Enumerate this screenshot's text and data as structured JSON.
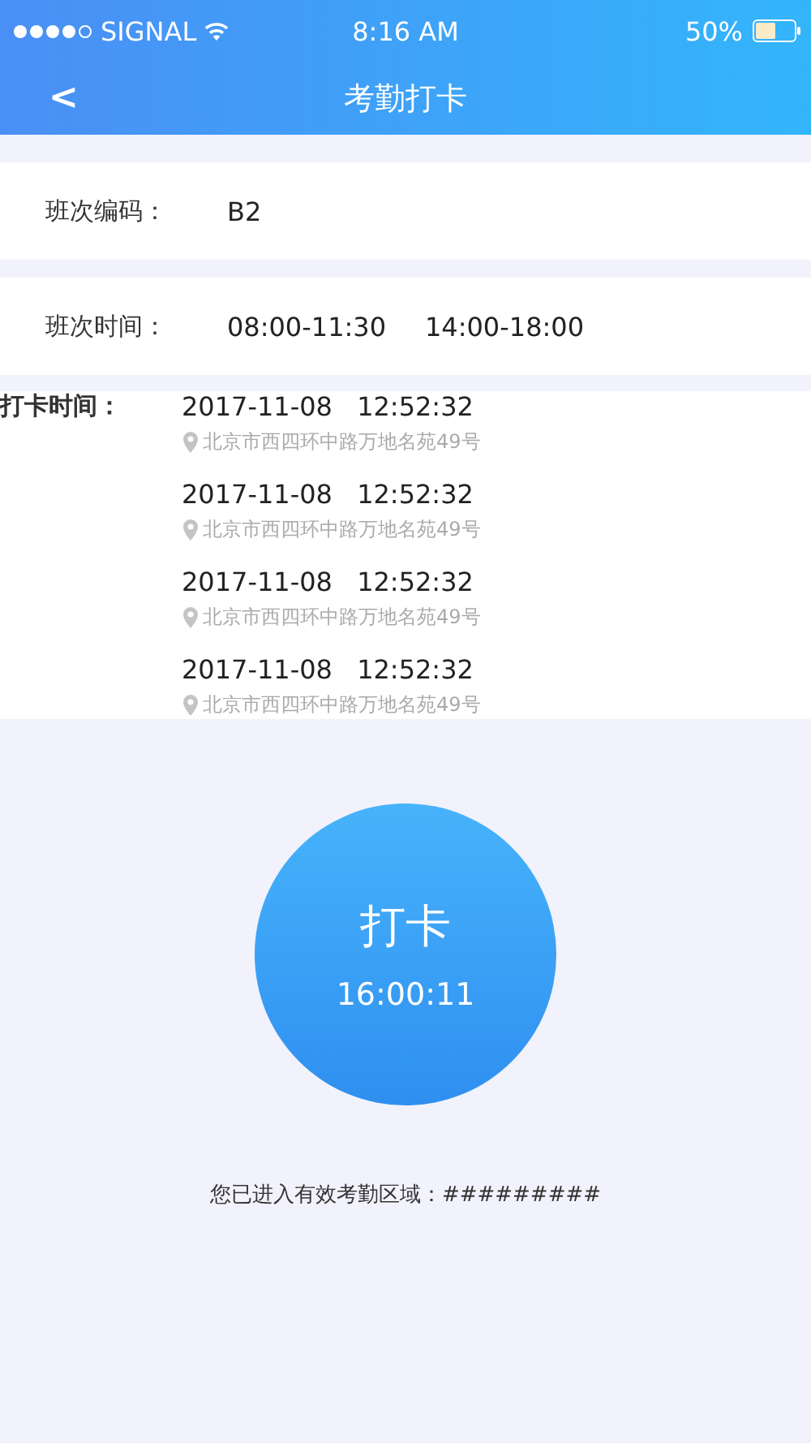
{
  "status_bar": {
    "carrier": "SIGNAL",
    "time": "8:16 AM",
    "battery": "50%"
  },
  "nav": {
    "back": "<",
    "title": "考勤打卡"
  },
  "shift_code": {
    "label": "班次编码：",
    "value": "B2"
  },
  "shift_time": {
    "label": "班次时间：",
    "ranges": [
      "08:00-11:30",
      "14:00-18:00"
    ]
  },
  "punch_records": {
    "label": "打卡时间：",
    "records": [
      {
        "date": "2017-11-08",
        "time": "12:52:32",
        "address": "北京市西四环中路万地名苑49号"
      },
      {
        "date": "2017-11-08",
        "time": "12:52:32",
        "address": "北京市西四环中路万地名苑49号"
      },
      {
        "date": "2017-11-08",
        "time": "12:52:32",
        "address": "北京市西四环中路万地名苑49号"
      },
      {
        "date": "2017-11-08",
        "time": "12:52:32",
        "address": "北京市西四环中路万地名苑49号"
      }
    ]
  },
  "punch_button": {
    "label": "打卡",
    "clock": "16:00:11"
  },
  "area_notice": "您已进入有效考勤区域：#########"
}
